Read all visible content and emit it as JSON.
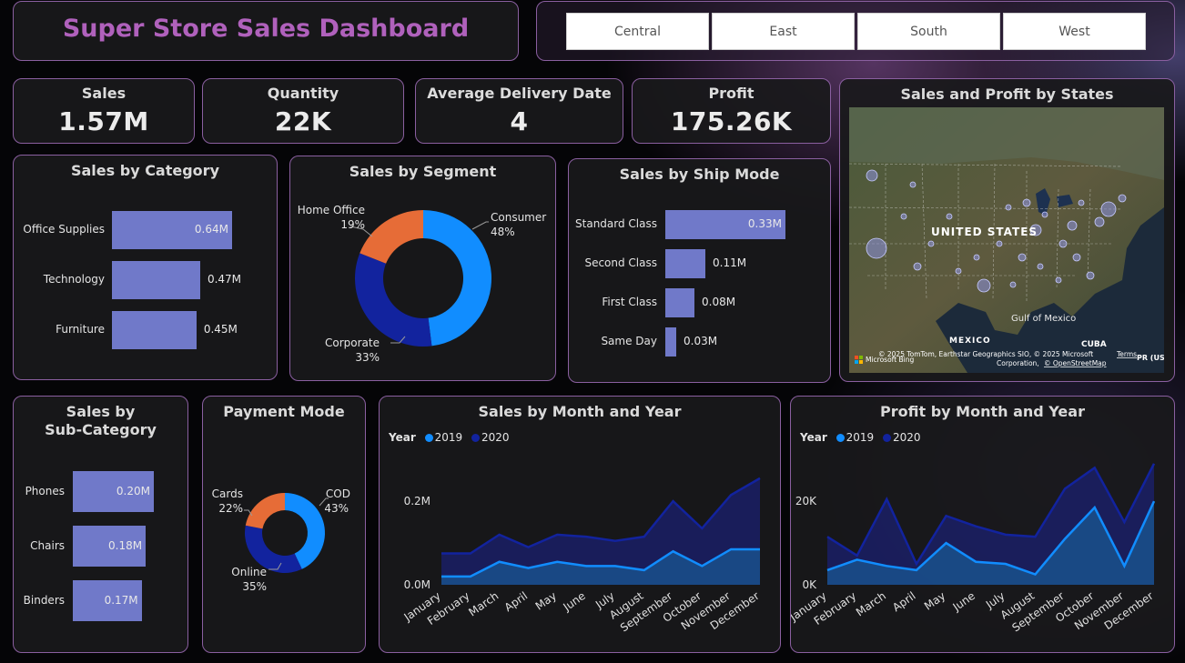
{
  "title": "Super Store Sales Dashboard",
  "slicer": [
    "Central",
    "East",
    "South",
    "West"
  ],
  "kpis": {
    "sales": {
      "label": "Sales",
      "value": "1.57M"
    },
    "quantity": {
      "label": "Quantity",
      "value": "22K"
    },
    "delivery": {
      "label": "Average Delivery Date",
      "value": "4"
    },
    "profit": {
      "label": "Profit",
      "value": "175.26K"
    }
  },
  "map": {
    "title": "Sales and Profit by States",
    "country": "UNITED STATES",
    "mexico": "MEXICO",
    "gulf": "Gulf of Mexico",
    "cuba": "CUBA",
    "pr": "PR (US)",
    "attribution": "© 2025 TomTom, Earthstar Geographics SIO, © 2025 Microsoft",
    "terms": "Terms",
    "attribution2": "Corporation,",
    "osm": "© OpenStreetMap",
    "bing": "Microsoft Bing"
  },
  "category": {
    "title": "Sales by Category",
    "items": [
      {
        "label": "Office Supplies",
        "value": 0.64,
        "text": "0.64M"
      },
      {
        "label": "Technology",
        "value": 0.47,
        "text": "0.47M"
      },
      {
        "label": "Furniture",
        "value": 0.45,
        "text": "0.45M"
      }
    ]
  },
  "segment": {
    "title": "Sales by Segment",
    "slices": [
      {
        "name": "Consumer",
        "pct": "48%",
        "value": 48,
        "color": "#118dff"
      },
      {
        "name": "Corporate",
        "pct": "33%",
        "value": 33,
        "color": "#12239e"
      },
      {
        "name": "Home Office",
        "pct": "19%",
        "value": 19,
        "color": "#e66c37"
      }
    ]
  },
  "shipmode": {
    "title": "Sales by Ship Mode",
    "items": [
      {
        "label": "Standard Class",
        "value": 0.33,
        "text": "0.33M"
      },
      {
        "label": "Second Class",
        "value": 0.11,
        "text": "0.11M"
      },
      {
        "label": "First Class",
        "value": 0.08,
        "text": "0.08M"
      },
      {
        "label": "Same Day",
        "value": 0.03,
        "text": "0.03M"
      }
    ]
  },
  "subcategory": {
    "title_line1": "Sales by",
    "title_line2": "Sub-Category",
    "items": [
      {
        "label": "Phones",
        "value": 0.2,
        "text": "0.20M"
      },
      {
        "label": "Chairs",
        "value": 0.18,
        "text": "0.18M"
      },
      {
        "label": "Binders",
        "value": 0.17,
        "text": "0.17M"
      }
    ]
  },
  "payment": {
    "title": "Payment Mode",
    "slices": [
      {
        "name": "COD",
        "pct": "43%",
        "value": 43,
        "color": "#118dff"
      },
      {
        "name": "Online",
        "pct": "35%",
        "value": 35,
        "color": "#12239e"
      },
      {
        "name": "Cards",
        "pct": "22%",
        "value": 22,
        "color": "#e66c37"
      }
    ]
  },
  "legend": {
    "label": "Year",
    "y2019": "2019",
    "y2020": "2020",
    "c2019": "#118dff",
    "c2020": "#12239e"
  },
  "chart_data": [
    {
      "type": "area",
      "title": "Sales by Month and Year",
      "categories": [
        "January",
        "February",
        "March",
        "April",
        "May",
        "June",
        "July",
        "August",
        "September",
        "October",
        "November",
        "December"
      ],
      "yticks": [
        "0.0M",
        "0.2M"
      ],
      "ylim": [
        0,
        0.32
      ],
      "series": [
        {
          "name": "2019",
          "values": [
            0.02,
            0.02,
            0.055,
            0.04,
            0.055,
            0.045,
            0.045,
            0.035,
            0.08,
            0.045,
            0.085,
            0.085
          ]
        },
        {
          "name": "2020",
          "values": [
            0.075,
            0.075,
            0.12,
            0.09,
            0.12,
            0.115,
            0.105,
            0.115,
            0.2,
            0.135,
            0.215,
            0.255
          ]
        }
      ]
    },
    {
      "type": "area",
      "title": "Profit by Month and Year",
      "categories": [
        "January",
        "February",
        "March",
        "April",
        "May",
        "June",
        "July",
        "August",
        "September",
        "October",
        "November",
        "December"
      ],
      "yticks": [
        "0K",
        "20K"
      ],
      "ylim": [
        0,
        32000
      ],
      "series": [
        {
          "name": "2019",
          "values": [
            3500,
            6000,
            4500,
            3500,
            10000,
            5500,
            5000,
            2500,
            11000,
            18500,
            4500,
            20000
          ]
        },
        {
          "name": "2020",
          "values": [
            11500,
            7000,
            20500,
            5000,
            16500,
            14000,
            12000,
            11500,
            23000,
            28000,
            15000,
            29000
          ]
        }
      ]
    }
  ]
}
